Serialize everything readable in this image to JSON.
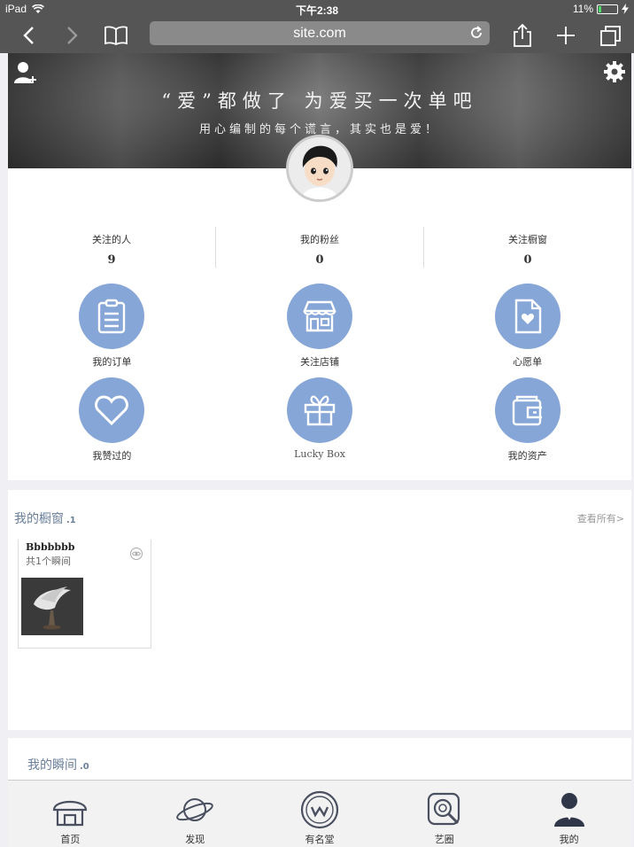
{
  "status_bar": {
    "device": "iPad",
    "time": "下午2:38",
    "battery": "11%"
  },
  "browser": {
    "url": "site.com"
  },
  "banner": {
    "headline": "“爱”都做了 为爱买一次单吧",
    "subline": "用心编制的每个谎言，其实也是爱！"
  },
  "stats": [
    {
      "label": "关注的人",
      "value": "9"
    },
    {
      "label": "我的粉丝",
      "value": "0"
    },
    {
      "label": "关注橱窗",
      "value": "0"
    }
  ],
  "menu": [
    {
      "label": "我的订单",
      "icon": "clipboard-icon"
    },
    {
      "label": "关注店铺",
      "icon": "store-icon"
    },
    {
      "label": "心愿单",
      "icon": "heart-file-icon"
    },
    {
      "label": "我赞过的",
      "icon": "heart-icon"
    },
    {
      "label": "Lucky Box",
      "icon": "gift-icon"
    },
    {
      "label": "我的资产",
      "icon": "wallet-icon"
    }
  ],
  "showcase": {
    "title": "我的橱窗",
    "count": ".1",
    "view_all": "查看所有>",
    "card": {
      "name": "Bbbbbbb",
      "subtitle": "共1个瞬间"
    }
  },
  "moments": {
    "title": "我的瞬间",
    "count": ".0"
  },
  "tabs": [
    {
      "label": "首页",
      "icon": "home-icon"
    },
    {
      "label": "发现",
      "icon": "planet-icon"
    },
    {
      "label": "有名堂",
      "icon": "w-badge-icon"
    },
    {
      "label": "艺圈",
      "icon": "search-frame-icon"
    },
    {
      "label": "我的",
      "icon": "profile-icon"
    }
  ],
  "colors": {
    "accent": "#87a6d8",
    "section_title": "#6a7f9a",
    "chrome": "#555555"
  }
}
